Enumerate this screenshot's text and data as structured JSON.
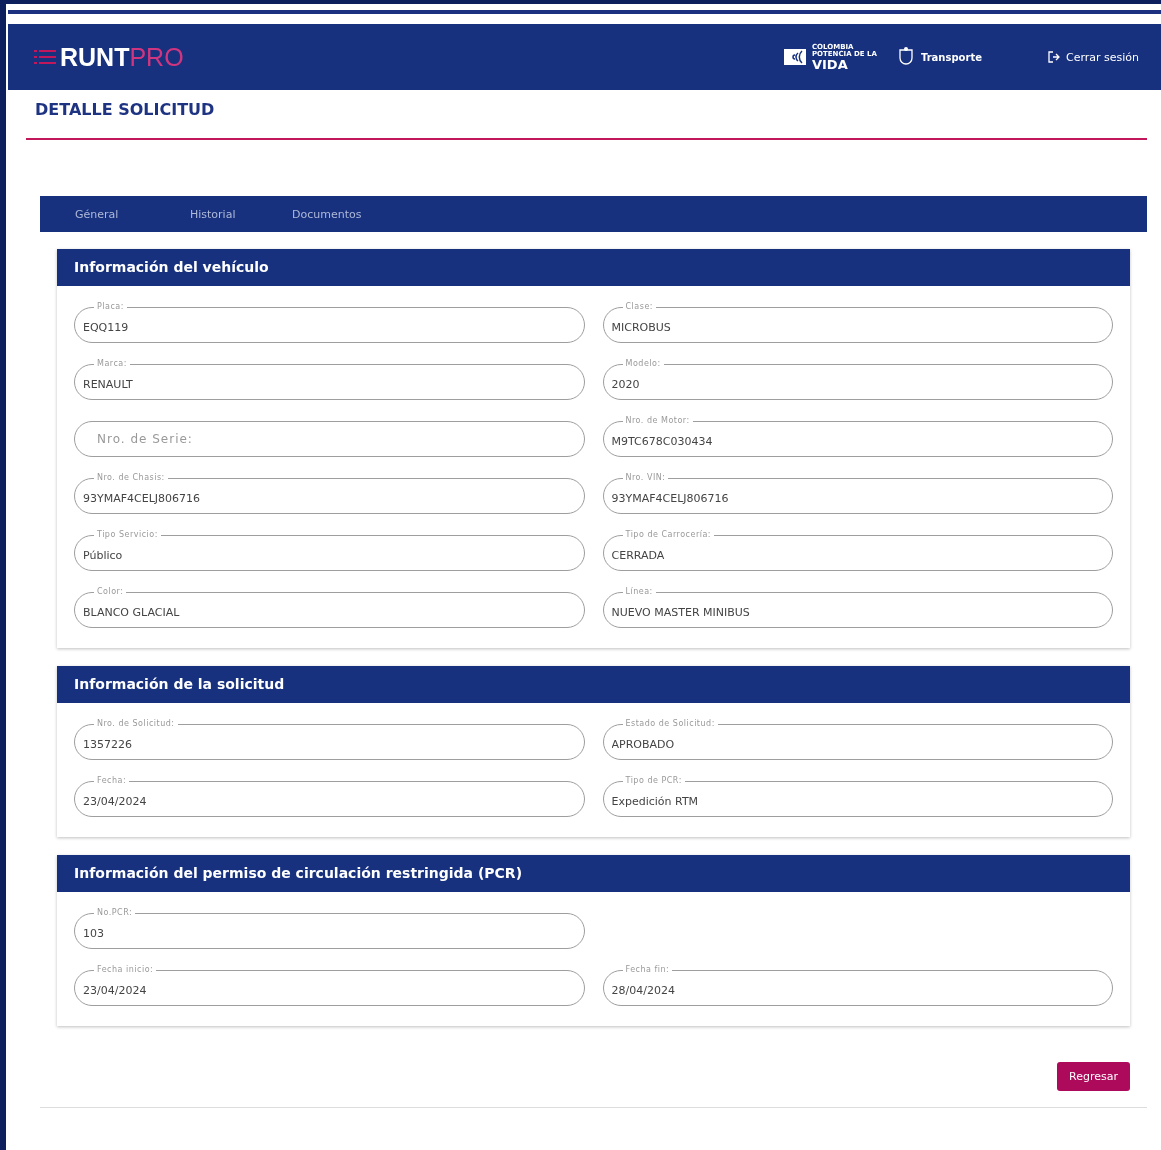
{
  "header": {
    "logo_main": "RUNT",
    "logo_accent": "PRO",
    "brand_top": "COLOMBIA",
    "brand_middle": "POTENCIA DE LA",
    "brand_bottom": "VIDA",
    "ministry": "Transporte",
    "logout": "Cerrar sesión"
  },
  "page_title": "DETALLE SOLICITUD",
  "tabs": [
    {
      "label": "Géneral"
    },
    {
      "label": "Historial"
    },
    {
      "label": "Documentos"
    }
  ],
  "sections": [
    {
      "title": "Información del vehículo",
      "rows": [
        [
          {
            "label": "Placa:",
            "value": "EQQ119"
          },
          {
            "label": "Clase:",
            "value": "MICROBUS"
          }
        ],
        [
          {
            "label": "Marca:",
            "value": "RENAULT"
          },
          {
            "label": "Modelo:",
            "value": "2020"
          }
        ],
        [
          {
            "placeholder": "Nro. de Serie:"
          },
          {
            "label": "Nro. de Motor:",
            "value": "M9TC678C030434"
          }
        ],
        [
          {
            "label": "Nro. de Chasis:",
            "value": "93YMAF4CELJ806716"
          },
          {
            "label": "Nro. VIN:",
            "value": "93YMAF4CELJ806716"
          }
        ],
        [
          {
            "label": "Tipo Servicio:",
            "value": "Público"
          },
          {
            "label": "Tipo de Carrocería:",
            "value": "CERRADA"
          }
        ],
        [
          {
            "label": "Color:",
            "value": "BLANCO GLACIAL"
          },
          {
            "label": "Línea:",
            "value": "NUEVO MASTER MINIBUS"
          }
        ]
      ]
    },
    {
      "title": "Información de la solicitud",
      "rows": [
        [
          {
            "label": "Nro. de Solicitud:",
            "value": "1357226"
          },
          {
            "label": "Estado de Solicitud:",
            "value": "APROBADO"
          }
        ],
        [
          {
            "label": "Fecha:",
            "value": "23/04/2024"
          },
          {
            "label": "Tipo de PCR:",
            "value": "Expedición RTM"
          }
        ]
      ]
    },
    {
      "title": "Información del permiso de circulación restringida (PCR)",
      "rows": [
        [
          {
            "label": "No.PCR:",
            "value": "103"
          }
        ],
        [
          {
            "label": "Fecha inicio:",
            "value": "23/04/2024"
          },
          {
            "label": "Fecha fin:",
            "value": "28/04/2024"
          }
        ]
      ]
    }
  ],
  "back_button": "Regresar"
}
